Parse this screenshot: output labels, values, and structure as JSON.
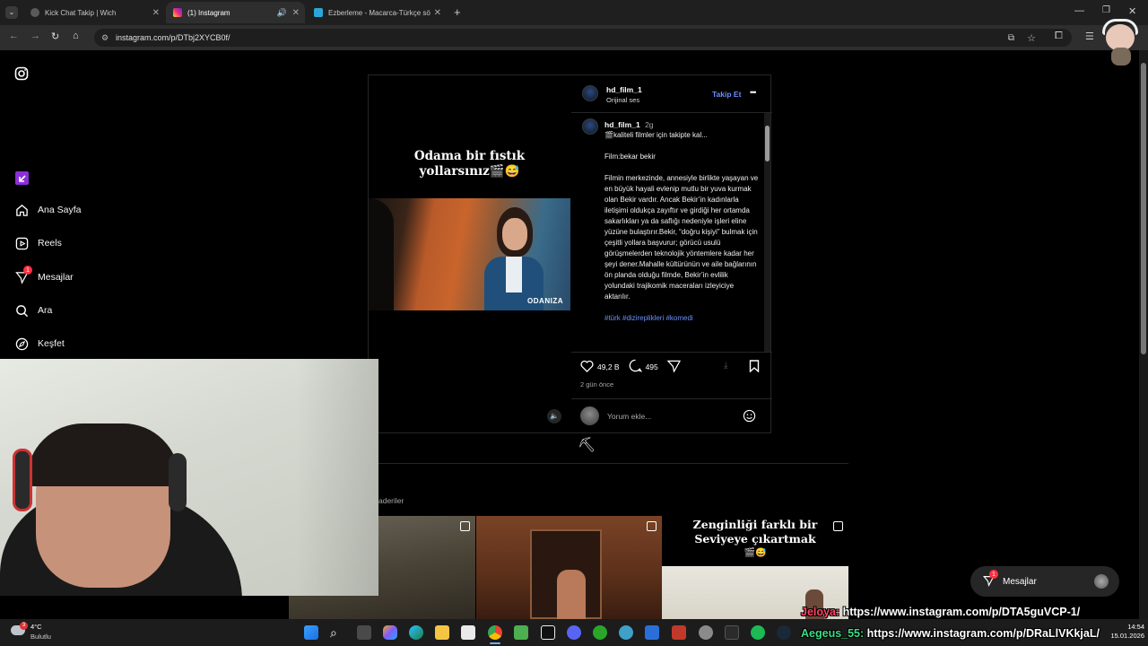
{
  "tabs": [
    {
      "title": "Kick Chat Takip | Wich",
      "active": false
    },
    {
      "title": "(1) Instagram",
      "active": true
    },
    {
      "title": "Ezberleme - Macarca-Türkçe sö",
      "active": false
    }
  ],
  "address_bar": {
    "url": "instagram.com/p/DTbj2XYCB0f/"
  },
  "sidebar": {
    "items": [
      {
        "label": "Ana Sayfa",
        "icon": "home-icon"
      },
      {
        "label": "Reels",
        "icon": "reels-icon"
      },
      {
        "label": "Mesajlar",
        "icon": "messages-icon",
        "badge": "1"
      },
      {
        "label": "Ara",
        "icon": "search-icon"
      },
      {
        "label": "Keşfet",
        "icon": "compass-icon"
      }
    ]
  },
  "post": {
    "video_caption_line1": "Odama bir fıstık",
    "video_caption_line2": "yollarsınız🎬😅",
    "frame_watermark": "ODANIZA",
    "author": "hd_film_1",
    "audio": "Orijinal ses",
    "follow_label": "Takip Et",
    "more_label": "•••",
    "comment_author": "hd_film_1",
    "comment_age": "2g",
    "caption_first": "🎬kaliteli filmler için takipte kal...",
    "caption_film": "Film:bekar bekir",
    "caption_body": "Filmin merkezinde, annesiyle birlikte yaşayan ve en büyük hayali evlenip mutlu bir yuva kurmak olan Bekir vardır. Ancak Bekir’in kadınlarla iletişimi oldukça zayıftır ve girdiği her ortamda sakarlıkları ya da saflığı nedeniyle işleri eline yüzüne bulaştırır.Bekir, “doğru kişiyi” bulmak için çeşitli yollara başvurur; görücü usulü görüşmelerden teknolojik yöntemlere kadar her şeyi dener.Mahalle kültürünün ve aile bağlarının ön planda olduğu filmde, Bekir’in evlilik yolundaki trajikomik maceraları izleyiciye aktarılır.",
    "hashtags": "#türk #dizireplikleri #komedi",
    "likes": "49,2 B",
    "comments": "495",
    "posted": "2 gün önce",
    "comment_placeholder": "Yorum ekle..."
  },
  "more_posts": {
    "label_partial": "aderiler",
    "tile3_text_line1": "Zenginliği farklı bir",
    "tile3_text_line2": "Seviyeye çıkartmak",
    "tile3_text_line3": "🎬😅"
  },
  "dm_pill": {
    "label": "Mesajlar",
    "badge": "1"
  },
  "overlay_chat": [
    {
      "user": "Jeloya:",
      "message": "https://www.instagram.com/p/DTA5guVCP-1/",
      "user_color": "#ff4466"
    },
    {
      "user": "Aegeus_55:",
      "message": "https://www.instagram.com/p/DRaLlVKkjaL/",
      "user_color": "#3ddc84"
    }
  ],
  "taskbar": {
    "weather_temp": "4°C",
    "weather_desc": "Bulutlu",
    "weather_badge": "3",
    "time": "14:54",
    "date": "15.01.2026"
  }
}
